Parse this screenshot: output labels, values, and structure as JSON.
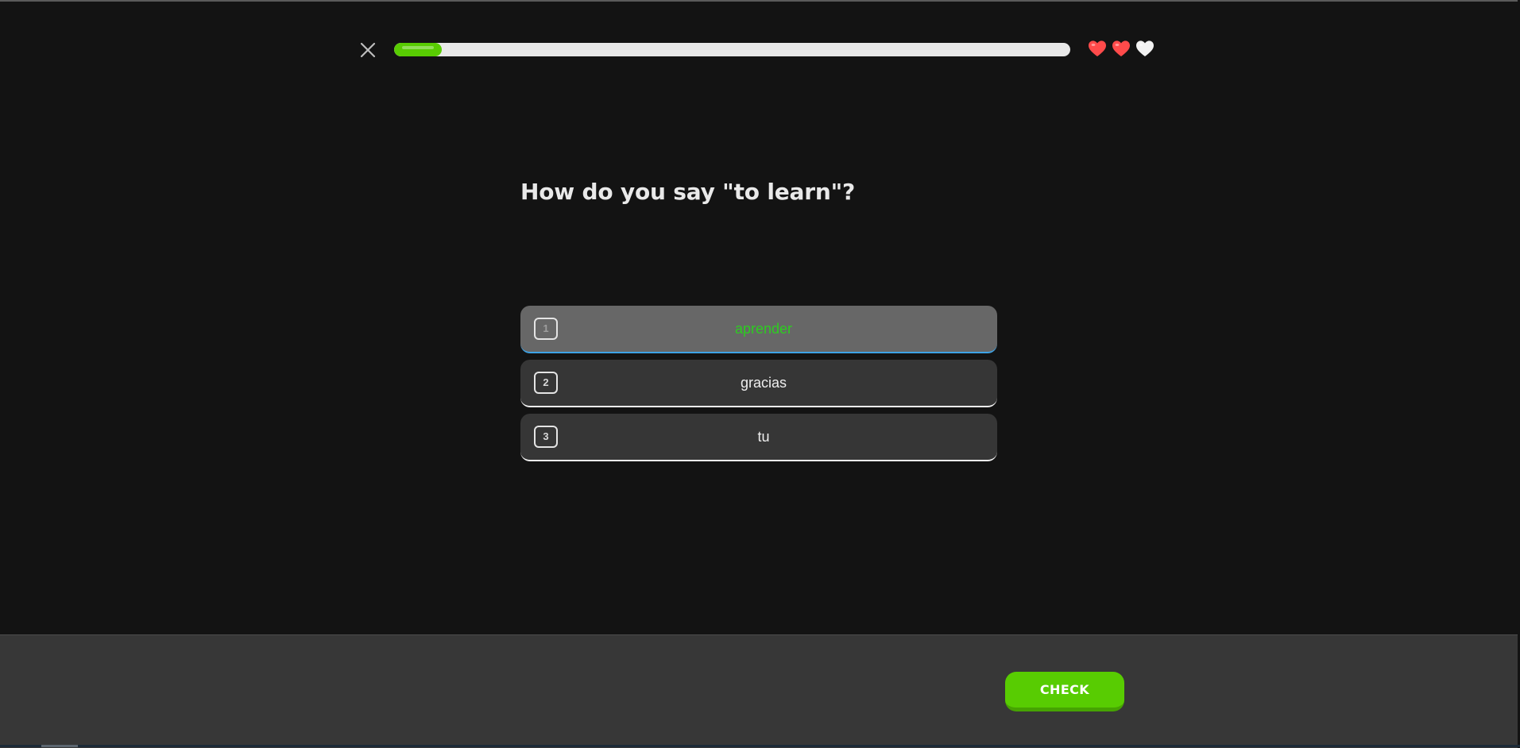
{
  "header": {
    "close_icon": "close-icon",
    "progress": 0.07,
    "hearts": [
      {
        "icon": "heart-icon",
        "color": "#ff4b4b"
      },
      {
        "icon": "heart-icon",
        "color": "#ff4b4b"
      },
      {
        "icon": "heart-icon",
        "color": "#f2f2f2"
      }
    ]
  },
  "question": {
    "text": "How do you say \"to learn\"?"
  },
  "options": [
    {
      "number": "1",
      "text": "aprender",
      "selected": true
    },
    {
      "number": "2",
      "text": "gracias",
      "selected": false
    },
    {
      "number": "3",
      "text": "tu",
      "selected": false
    }
  ],
  "footer": {
    "check_label": "CHECK"
  },
  "colors": {
    "accent": "#58cc02",
    "selected_text": "#2dcc21",
    "selected_border": "#3da3e6",
    "heart_full": "#ff4b4b",
    "heart_empty": "#f2f2f2"
  }
}
